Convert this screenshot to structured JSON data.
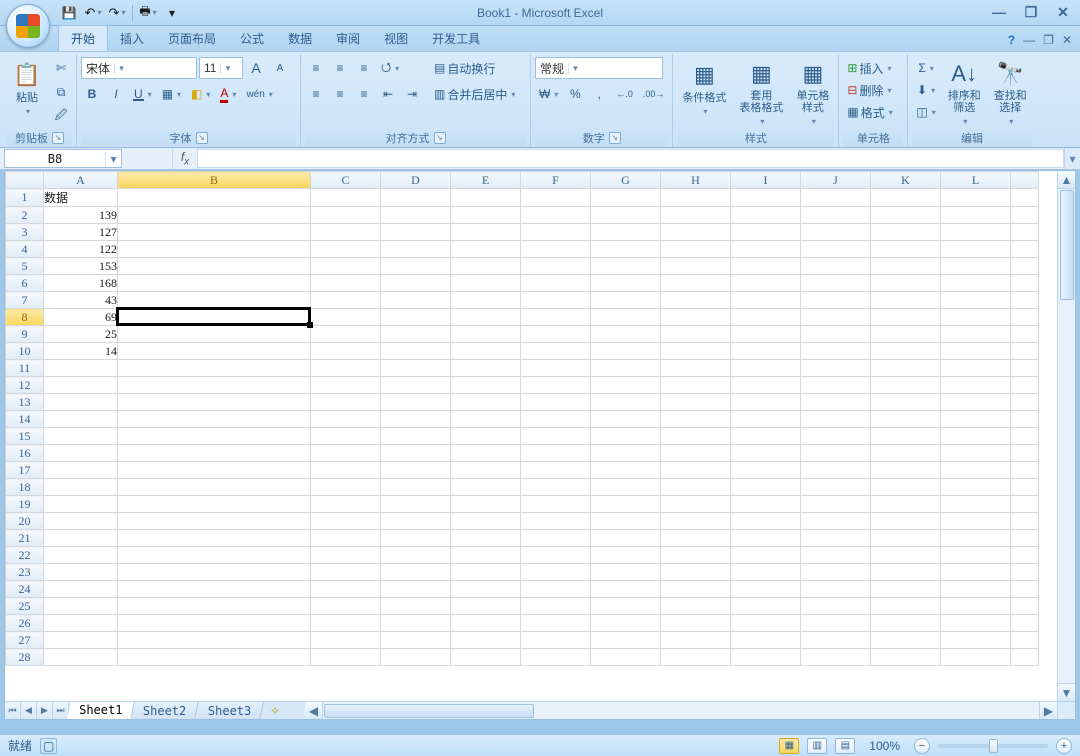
{
  "app": {
    "title": "Book1 - Microsoft Excel",
    "status_ready": "就绪"
  },
  "qat": {
    "save": "💾",
    "undo": "↶",
    "redo": "↷",
    "print": "🖶"
  },
  "win": {
    "minimize": "—",
    "restore": "❐",
    "close": "✕"
  },
  "tabs": [
    "开始",
    "插入",
    "页面布局",
    "公式",
    "数据",
    "审阅",
    "视图",
    "开发工具"
  ],
  "tabs_active": 0,
  "tab_doc": {
    "help": "?",
    "min": "—",
    "rest": "❐",
    "close": "✕"
  },
  "groups": {
    "clipboard": {
      "label": "剪贴板",
      "paste": "粘贴",
      "cut": "✄",
      "copy": "⧉",
      "format_painter": "🖉"
    },
    "font": {
      "label": "字体",
      "name": "宋体",
      "size": "11",
      "grow": "A",
      "shrink": "A",
      "bold": "B",
      "italic": "I",
      "underline": "U",
      "border": "▦",
      "fill": "◧",
      "color": "A",
      "phonetic": "wén"
    },
    "align": {
      "label": "对齐方式",
      "top": "≡",
      "mid": "≡",
      "bot": "≡",
      "left": "≡",
      "center": "≡",
      "right": "≡",
      "indent_dec": "⇤",
      "indent_inc": "⇥",
      "orient": "⭯",
      "wrap": "自动换行",
      "merge": "合并后居中"
    },
    "number": {
      "label": "数字",
      "format": "常规",
      "currency": "₩",
      "percent": "%",
      "comma": ",",
      "inc_dec": "←.0",
      "dec_dec": ".00→"
    },
    "styles": {
      "label": "样式",
      "cond": "条件格式",
      "table": "套用\n表格格式",
      "cell": "单元格\n样式"
    },
    "cells": {
      "label": "单元格",
      "insert": "插入",
      "delete": "删除",
      "format": "格式"
    },
    "editing": {
      "label": "编辑",
      "autosum": "Σ",
      "fill": "⬇",
      "clear": "◫",
      "sort": "排序和\n筛选",
      "find": "查找和\n选择"
    }
  },
  "namebox": "B8",
  "formula": "",
  "columns": [
    "A",
    "B",
    "C",
    "D",
    "E",
    "F",
    "G",
    "H",
    "I",
    "J",
    "K",
    "L"
  ],
  "rows": [
    1,
    2,
    3,
    4,
    5,
    6,
    7,
    8,
    9,
    10,
    11,
    12,
    13,
    14,
    15,
    16,
    17,
    18,
    19,
    20,
    21,
    22,
    23,
    24,
    25,
    26,
    27,
    28
  ],
  "data": {
    "A1": "数据",
    "A2": "139",
    "A3": "127",
    "A4": "122",
    "A5": "153",
    "A6": "168",
    "A7": "43",
    "A8": "69",
    "A9": "25",
    "A10": "14"
  },
  "active_cell": "B8",
  "sheets": {
    "tabs": [
      "Sheet1",
      "Sheet2",
      "Sheet3"
    ],
    "active": 0
  },
  "zoom": {
    "value": "100%",
    "minus": "−",
    "plus": "+"
  },
  "views": {
    "normal": "▦",
    "layout": "▥",
    "pagebreak": "▤"
  }
}
